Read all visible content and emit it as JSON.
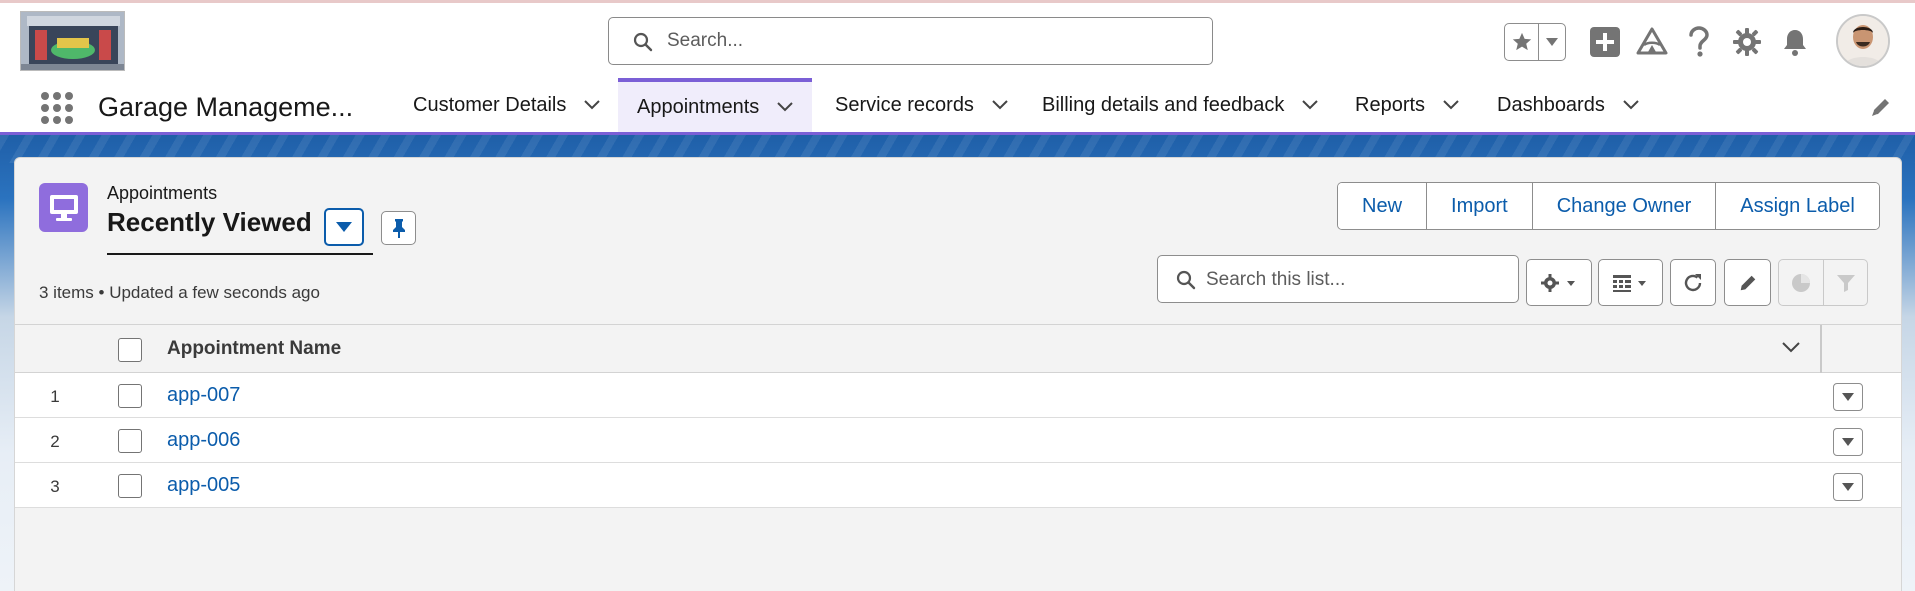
{
  "global_header": {
    "search_placeholder": "Search...",
    "icons": [
      "favorites-star-icon",
      "chevron-down-icon",
      "add-icon",
      "trailhead-icon",
      "help-icon",
      "setup-gear-icon",
      "notifications-bell-icon"
    ]
  },
  "app_nav": {
    "app_name": "Garage Manageme...",
    "tabs": [
      {
        "label": "Customer Details",
        "active": false
      },
      {
        "label": "Appointments",
        "active": true
      },
      {
        "label": "Service records",
        "active": false
      },
      {
        "label": "Billing details and feedback",
        "active": false
      },
      {
        "label": "Reports",
        "active": false
      },
      {
        "label": "Dashboards",
        "active": false
      }
    ]
  },
  "list_view": {
    "object_label": "Appointments",
    "title": "Recently Viewed",
    "status": "3 items • Updated a few seconds ago",
    "search_placeholder": "Search this list...",
    "actions": [
      "New",
      "Import",
      "Change Owner",
      "Assign Label"
    ],
    "columns": [
      "Appointment Name"
    ],
    "rows": [
      {
        "num": "1",
        "name": "app-007"
      },
      {
        "num": "2",
        "name": "app-006"
      },
      {
        "num": "3",
        "name": "app-005"
      }
    ]
  },
  "colors": {
    "brand_blue": "#0b5cab",
    "accent_purple": "#7b5fd6",
    "object_icon": "#8f6ddd"
  }
}
